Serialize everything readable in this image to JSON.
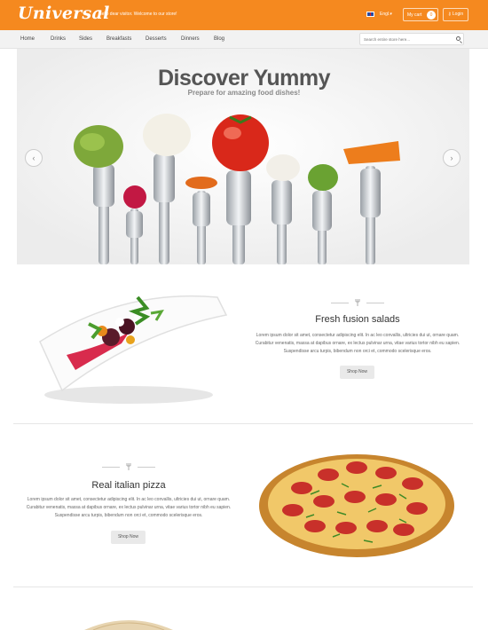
{
  "header": {
    "logo": "Universal",
    "welcome": "Hello dear visitor. Welcome to our store!",
    "lang": "Engl.▾",
    "cart_label": "My cart",
    "cart_count": "0",
    "login": "Login"
  },
  "nav": {
    "items": [
      "Home",
      "Drinks",
      "Sides",
      "Breakfasts",
      "Desserts",
      "Dinners",
      "Blog"
    ]
  },
  "search": {
    "placeholder": "Search entire store here..."
  },
  "hero": {
    "title": "Discover Yummy",
    "subtitle": "Prepare for amazing food dishes!"
  },
  "features": [
    {
      "title": "Fresh fusion salads",
      "text": "Lorem ipsum dolor sit amet, consectetur adipiscing elit. In ac leo convallis, ultricies dui ut, ornare quam. Curabitur venenatis, massa at dapibus ornare, ex lectus pulvinar urna, vitae varius tortor nibh eu sapien. Suspendisse arcu turpis, bibendum non orci et, commodo scelerisque eros.",
      "button": "Shop Now"
    },
    {
      "title": "Real italian pizza",
      "text": "Lorem ipsum dolor sit amet, consectetur adipiscing elit. In ac leo convallis, ultricies dui ut, ornare quam. Curabitur venenatis, massa at dapibus ornare, ex lectus pulvinar urna, vitae varius tortor nibh eu sapien. Suspendisse arcu turpis, bibendum non orci et, commodo scelerisque eros.",
      "button": "Shop Now"
    }
  ],
  "colors": {
    "brand": "#f5891f",
    "navbar": "#f2f2f2"
  },
  "icons": [
    "flag-icon",
    "search-icon",
    "fork-icon",
    "chevron-left-icon",
    "chevron-right-icon"
  ]
}
